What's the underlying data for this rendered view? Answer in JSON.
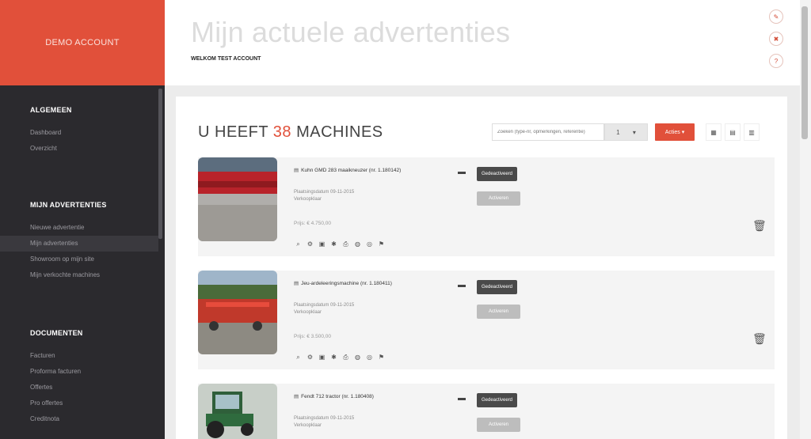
{
  "brand": {
    "label": "DEMO ACCOUNT"
  },
  "header": {
    "title": "Mijn actuele advertenties",
    "subtitle": "WELKOM TEST ACCOUNT",
    "icons": [
      "edit-icon",
      "close-icon",
      "help-icon"
    ]
  },
  "sidebar": {
    "sections": [
      {
        "heading": "ALGEMEEN",
        "items": [
          {
            "label": "Dashboard"
          },
          {
            "label": "Overzicht"
          }
        ]
      },
      {
        "heading": "MIJN ADVERTENTIES",
        "items": [
          {
            "label": "Nieuwe advertentie"
          },
          {
            "label": "Mijn advertenties",
            "active": true
          },
          {
            "label": "Showroom op mijn site"
          },
          {
            "label": "Mijn verkochte machines"
          }
        ]
      },
      {
        "heading": "DOCUMENTEN",
        "items": [
          {
            "label": "Facturen"
          },
          {
            "label": "Proforma facturen"
          },
          {
            "label": "Offertes"
          },
          {
            "label": "Pro offertes"
          },
          {
            "label": "Creditnota"
          }
        ]
      }
    ]
  },
  "main": {
    "count_prefix": "U HEEFT ",
    "count_value": "38",
    "count_suffix": " MACHINES",
    "search_placeholder": "Zoeken (type-nr, opmerkingen, referentie)",
    "filter_label": "1",
    "action_label": "Acties",
    "view_icons": [
      "grid-view-icon",
      "list-view-icon",
      "table-view-icon"
    ]
  },
  "listings": [
    {
      "title": "Kuhn GMD 283 maaikneuzer (nr. 1.180142)",
      "meta1": "Plaatsingsdatum 09-11-2015",
      "meta2": "Verkoopklaar",
      "price": "Prijs: € 4.750,00",
      "status": "Gedeactiveerd",
      "sub": "Activeren",
      "image": "red-mower"
    },
    {
      "title": "Jeu-ardeleeringsmachine (nr. 1.180411)",
      "meta1": "Plaatsingsdatum 09-11-2015",
      "meta2": "Verkoopklaar",
      "price": "Prijs: € 3.500,00",
      "status": "Gedeactiveerd",
      "sub": "Activeren",
      "image": "red-tedder"
    },
    {
      "title": "Fendt 712 tractor (nr. 1.180408)",
      "meta1": "Plaatsingsdatum 09-11-2015",
      "meta2": "Verkoopklaar",
      "price": "",
      "status": "Gedeactiveerd",
      "sub": "Activeren",
      "image": "green-tractor"
    }
  ],
  "colors": {
    "accent": "#e1503a",
    "sidebar": "#2b2a2e"
  }
}
